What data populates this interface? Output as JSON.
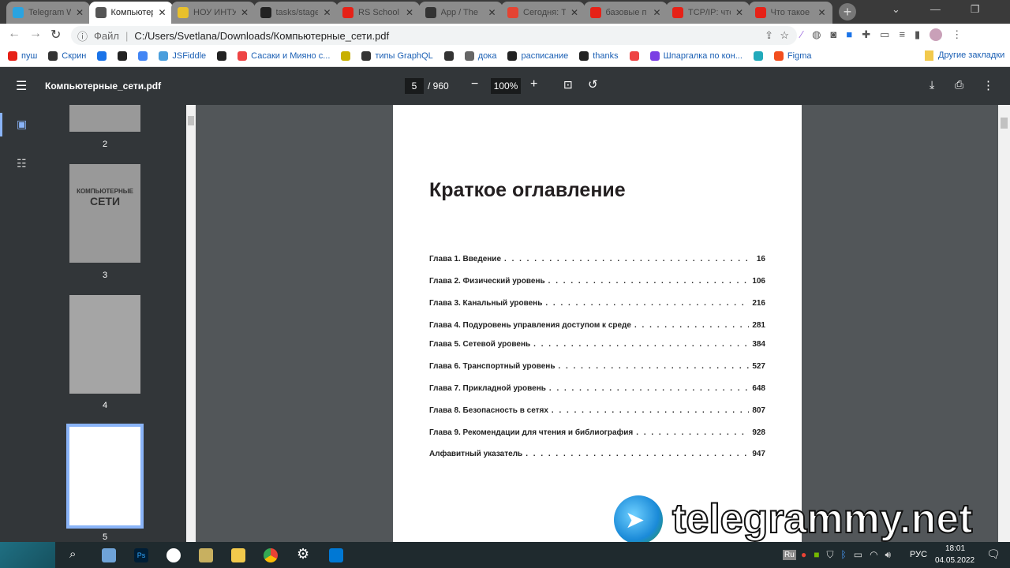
{
  "tabs": [
    {
      "label": "Telegram W",
      "color": "#2aa3e0"
    },
    {
      "label": "Компьютер",
      "color": "#555",
      "active": true
    },
    {
      "label": "НОУ ИНТУ",
      "color": "#e8c02c"
    },
    {
      "label": "tasks/stage",
      "color": "#222"
    },
    {
      "label": "RS School",
      "color": "#e62117"
    },
    {
      "label": "App / The",
      "color": "#333"
    },
    {
      "label": "Сегодня: Т",
      "color": "#e44332"
    },
    {
      "label": "базовые п",
      "color": "#e62117"
    },
    {
      "label": "TCP/IP: что",
      "color": "#e62117"
    },
    {
      "label": "Что такое",
      "color": "#e62117"
    }
  ],
  "address": {
    "prefix": "Файл",
    "url": "C:/Users/Svetlana/Downloads/Компьютерные_сети.pdf"
  },
  "bookmarks": [
    "пуш",
    "Скрин",
    "",
    "",
    "",
    "JSFiddle",
    "",
    "Сасаки и Мияно с...",
    "",
    "типы GraphQL",
    "",
    "дока",
    "расписание",
    "thanks",
    "",
    "Шпаргалка по кон...",
    "",
    "Figma"
  ],
  "other_bookmarks": "Другие закладки",
  "pdf": {
    "title": "Компьютерные_сети.pdf",
    "page": "5",
    "total": "/ 960",
    "zoom": "100%"
  },
  "thumbs": [
    "2",
    "3",
    "4",
    "5"
  ],
  "thumb_cover": {
    "line1": "КОМПЬЮТЕРНЫЕ",
    "line2": "СЕТИ"
  },
  "page": {
    "heading": "Краткое оглавление",
    "toc": [
      {
        "t": "Глава 1. Введение",
        "p": "16"
      },
      {
        "t": "Глава 2. Физический уровень",
        "p": "106"
      },
      {
        "t": "Глава 3. Канальный уровень",
        "p": "216"
      },
      {
        "t": "Глава 4. Подуровень управления доступом к среде",
        "p": "281"
      },
      {
        "t": "Глава 5. Сетевой уровень",
        "p": "384"
      },
      {
        "t": "Глава 6. Транспортный уровень",
        "p": "527"
      },
      {
        "t": "Глава 7. Прикладной уровень",
        "p": "648"
      },
      {
        "t": "Глава 8. Безопасность в сетях",
        "p": "807"
      },
      {
        "t": "Глава 9. Рекомендации для чтения и библиография",
        "p": "928"
      },
      {
        "t": "Алфавитный указатель",
        "p": "947"
      }
    ]
  },
  "watermark": "telegrammy.net",
  "tray": {
    "lang_badge": "Ru",
    "lang": "РУС",
    "time": "18:01",
    "date": "04.05.2022"
  }
}
